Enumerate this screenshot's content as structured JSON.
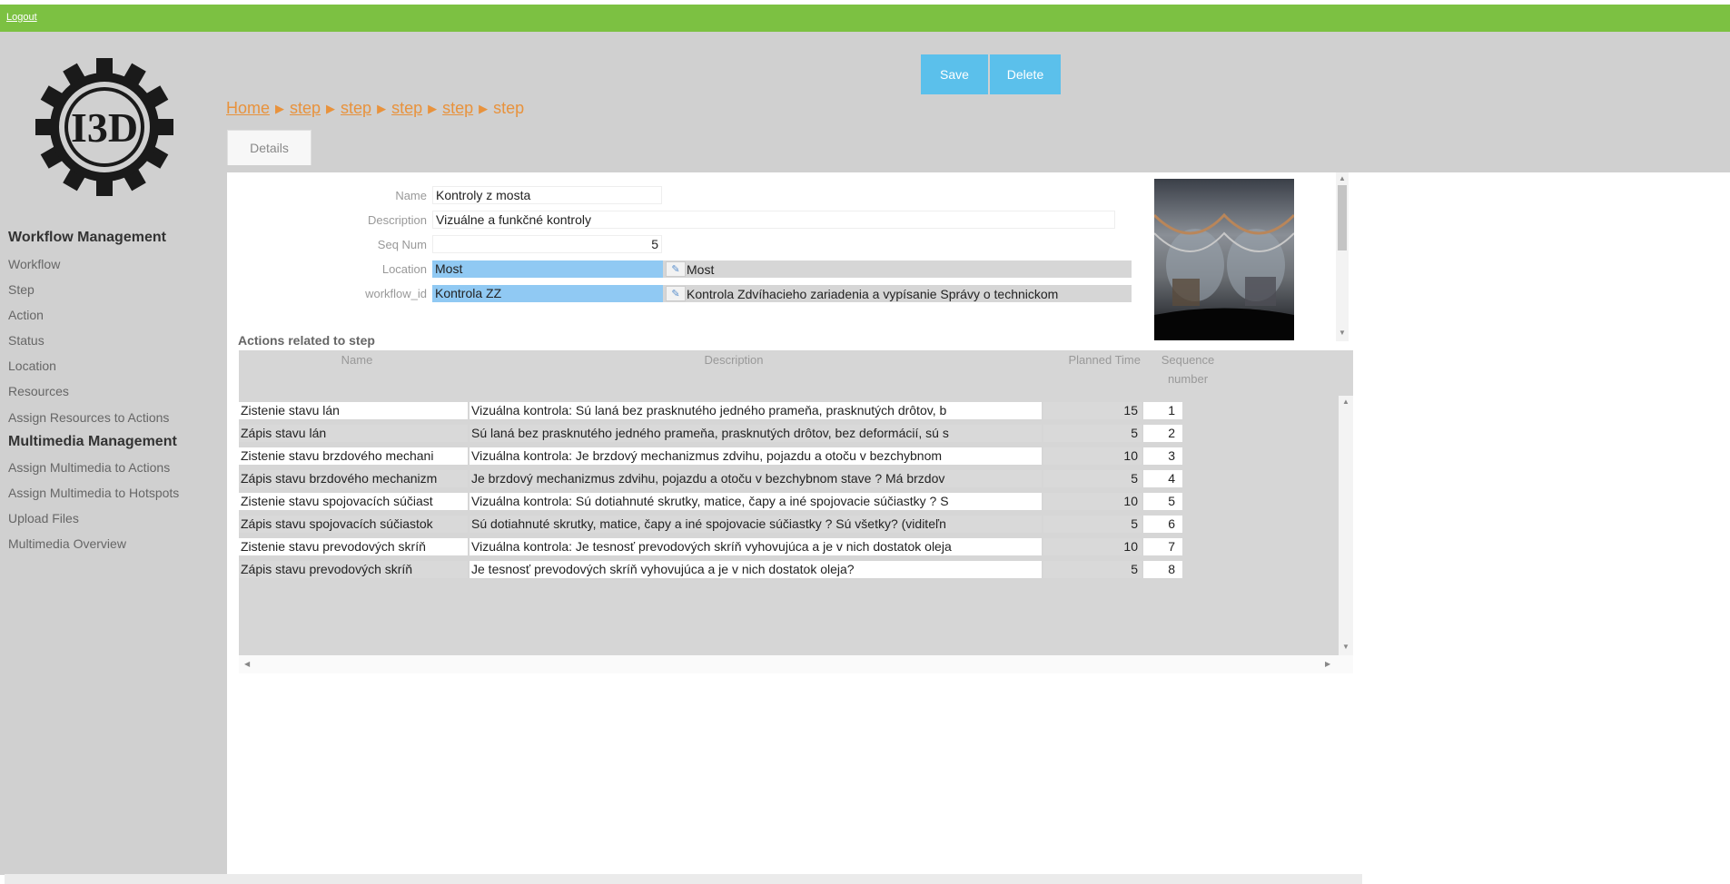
{
  "topbar": {
    "logout_label": "Logout",
    "color": "#7cc142"
  },
  "logo": {
    "text": "I3D"
  },
  "toolbar": {
    "save_label": "Save",
    "delete_label": "Delete"
  },
  "breadcrumb": [
    "Home",
    "step",
    "step",
    "step",
    "step",
    "step"
  ],
  "tabs": [
    {
      "label": "Details"
    }
  ],
  "sidebar": {
    "workflow_group": "Workflow Management",
    "workflow_items": [
      "Workflow",
      "Step",
      "Action",
      "Status",
      "Location",
      "Resources",
      "Assign Resources to Actions"
    ],
    "multimedia_group": "Multimedia Management",
    "multimedia_items": [
      "Assign Multimedia to Actions",
      "Assign Multimedia to Hotspots",
      "Upload Files",
      "Multimedia Overview"
    ]
  },
  "form": {
    "name_label": "Name",
    "name_value": "Kontroly z mosta",
    "description_label": "Description",
    "description_value": "Vizuálne a funkčné kontroly",
    "seq_label": "Seq Num",
    "seq_value": "5",
    "location_label": "Location",
    "location_value": "Most",
    "location_lookup": "Most",
    "workflow_label": "workflow_id",
    "workflow_value": "Kontrola ZZ",
    "workflow_lookup": "Kontrola Zdvíhacieho zariadenia a vypísanie Správy o technickom"
  },
  "actions": {
    "title": "Actions related to step",
    "headers": {
      "name": "Name",
      "description": "Description",
      "planned_time": "Planned Time",
      "sequence_line1": "Sequence",
      "sequence_line2": "number"
    },
    "rows": [
      {
        "name": "Zistenie stavu lán",
        "description": "Vizuálna kontrola: Sú laná bez prasknutého jedného prameňa, prasknutých drôtov, b",
        "planned_time": "15",
        "sequence": "1"
      },
      {
        "name": "Zápis stavu lán",
        "description": "Sú laná bez prasknutého jedného prameňa, prasknutých drôtov, bez deformácií, sú s",
        "planned_time": "5",
        "sequence": "2"
      },
      {
        "name": "Zistenie stavu brzdového mechani",
        "description": "Vizuálna kontrola: Je brzdový mechanizmus  zdvihu, pojazdu a otoču v bezchybnom",
        "planned_time": "10",
        "sequence": "3"
      },
      {
        "name": "Zápis stavu brzdového mechanizm",
        "description": "Je brzdový mechanizmus  zdvihu, pojazdu a otoču v bezchybnom stave ? Má brzdov",
        "planned_time": "5",
        "sequence": "4"
      },
      {
        "name": "Zistenie stavu spojovacích súčiast",
        "description": "Vizuálna kontrola: Sú dotiahnuté skrutky, matice, čapy a iné spojovacie súčiastky ? S",
        "planned_time": "10",
        "sequence": "5"
      },
      {
        "name": "Zápis stavu spojovacích súčiastok",
        "description": "Sú dotiahnuté skrutky, matice, čapy a iné spojovacie súčiastky ? Sú všetky? (viditeľn",
        "planned_time": "5",
        "sequence": "6"
      },
      {
        "name": "Zistenie stavu prevodových skríň",
        "description": "Vizuálna kontrola: Je tesnosť prevodových skríň vyhovujúca a je v nich dostatok oleja",
        "planned_time": "10",
        "sequence": "7"
      },
      {
        "name": "Zápis stavu prevodových skríň",
        "description": "Je tesnosť prevodových skríň vyhovujúca a je v nich dostatok oleja?",
        "planned_time": "5",
        "sequence": "8"
      }
    ]
  },
  "colors": {
    "accent": "#5bc0eb",
    "breadcrumb": "#e8923c",
    "selection": "#90c9f3",
    "panel": "#d0d0d0"
  },
  "icons": {
    "edit": "pencil-icon",
    "breadcrumb_separator": "triangle-right-icon"
  }
}
